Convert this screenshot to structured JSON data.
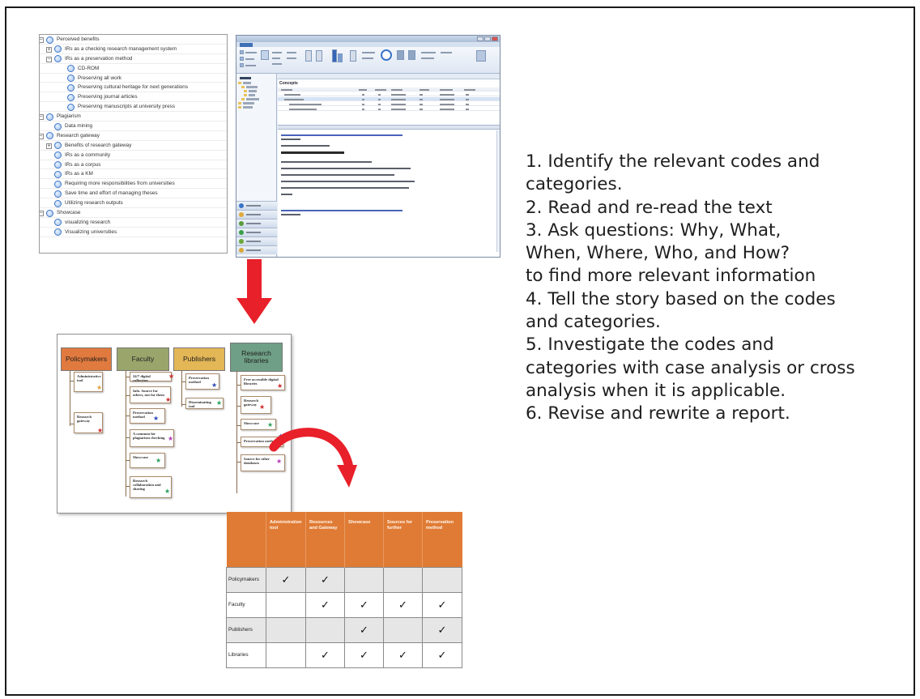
{
  "coding_tree": {
    "rows": [
      {
        "label": "Perceived benefits",
        "level": 0,
        "toggle": "−"
      },
      {
        "label": "IRs as a checking research management system",
        "level": 1,
        "toggle": "+"
      },
      {
        "label": "IRs as a preservation method",
        "level": 1,
        "toggle": "−"
      },
      {
        "label": "CD-ROM",
        "level": 2,
        "toggle": ""
      },
      {
        "label": "Preserving all work",
        "level": 2,
        "toggle": ""
      },
      {
        "label": "Preserving cultural heritage for next generations",
        "level": 2,
        "toggle": ""
      },
      {
        "label": "Preserving journal articles",
        "level": 2,
        "toggle": ""
      },
      {
        "label": "Preserving manuscripts at university press",
        "level": 2,
        "toggle": ""
      },
      {
        "label": "Plagiarism",
        "level": 0,
        "toggle": "−"
      },
      {
        "label": "Data mining",
        "level": 1,
        "toggle": ""
      },
      {
        "label": "Research gateway",
        "level": 0,
        "toggle": "−"
      },
      {
        "label": "Benefits of research gateway",
        "level": 1,
        "toggle": "+"
      },
      {
        "label": "IRs as a community",
        "level": 1,
        "toggle": ""
      },
      {
        "label": "IRs as a corpus",
        "level": 1,
        "toggle": ""
      },
      {
        "label": "IRs as a KM",
        "level": 1,
        "toggle": ""
      },
      {
        "label": "Requiring more responsibilities from universities",
        "level": 1,
        "toggle": ""
      },
      {
        "label": "Save time and effort of managing theses",
        "level": 1,
        "toggle": ""
      },
      {
        "label": "Utilizing research outputs",
        "level": 1,
        "toggle": ""
      },
      {
        "label": "Showcase",
        "level": 0,
        "toggle": "−"
      },
      {
        "label": "visualizing research",
        "level": 1,
        "toggle": ""
      },
      {
        "label": "Visualizing universities",
        "level": 1,
        "toggle": ""
      }
    ]
  },
  "nvivo": {
    "section_heading": "Concepts"
  },
  "stakeholders": {
    "headers": [
      {
        "id": "policymakers",
        "label": "Policymakers",
        "color": "#e17a3e"
      },
      {
        "id": "faculty",
        "label": "Faculty",
        "color": "#9aa56c"
      },
      {
        "id": "publishers",
        "label": "Publishers",
        "color": "#e3b656"
      },
      {
        "id": "libraries",
        "label": "Research libraries",
        "color": "#6f9f86"
      }
    ],
    "leaves": {
      "policymakers": [
        {
          "label": "Administrative tool",
          "star": "#e0a03a"
        },
        {
          "label": "Research gateway",
          "star": "#cc2b2b"
        }
      ],
      "faculty": [
        {
          "label": "24/7 digital collection",
          "star": "#cc2b2b"
        },
        {
          "label": "Info. Source for others, not for them",
          "star": "#cc2b2b"
        },
        {
          "label": "Preservation method",
          "star": "#2b48b8"
        },
        {
          "label": "A common for plagiarism checking",
          "star": "#b43ab8"
        },
        {
          "label": "Showcase",
          "star": "#2aa05a"
        },
        {
          "label": "Research collaboration and sharing",
          "star": "#2aa05a"
        }
      ],
      "publishers": [
        {
          "label": "Preservation method",
          "star": "#2b48b8"
        },
        {
          "label": "Disseminating tool",
          "star": "#2aa05a"
        }
      ],
      "libraries": [
        {
          "label": "Free accessible digital libraries",
          "star": "#cc2b2b"
        },
        {
          "label": "Research gateway",
          "star": "#cc2b2b"
        },
        {
          "label": "Showcase",
          "star": "#2aa05a"
        },
        {
          "label": "Preservation method",
          "star": "#2b48b8"
        },
        {
          "label": "Source for other databases",
          "star": "#b43ab8"
        }
      ]
    }
  },
  "matrix": {
    "columns": [
      "Administration tool",
      "Resources and Gateway",
      "Showcase",
      "Sources for further",
      "Preservation method"
    ],
    "rows": [
      {
        "label": "Policymakers",
        "checks": [
          "✓",
          "✓",
          "",
          "",
          ""
        ],
        "shaded": true
      },
      {
        "label": "Faculty",
        "checks": [
          "",
          "✓",
          "✓",
          "✓",
          "✓"
        ],
        "shaded": false
      },
      {
        "label": "Publishers",
        "checks": [
          "",
          "",
          "✓",
          "",
          "✓"
        ],
        "shaded": true
      },
      {
        "label": "Libraries",
        "checks": [
          "",
          "✓",
          "✓",
          "✓",
          "✓"
        ],
        "shaded": false
      }
    ]
  },
  "steps": [
    "1. Identify the relevant codes and",
    "categories.",
    "2. Read and re-read the text",
    "3. Ask questions: Why, What,",
    "When, Where, Who, and How?",
    "to find more relevant information",
    "4. Tell the story based on the codes",
    "and categories.",
    "5. Investigate the codes and",
    "categories with case analysis or cross",
    "analysis when it  is applicable.",
    "6. Revise and rewrite a report."
  ],
  "colors": {
    "arrow_red": "#e8202a",
    "matrix_header": "#e07b35",
    "node_blue": "#3a74c8"
  }
}
